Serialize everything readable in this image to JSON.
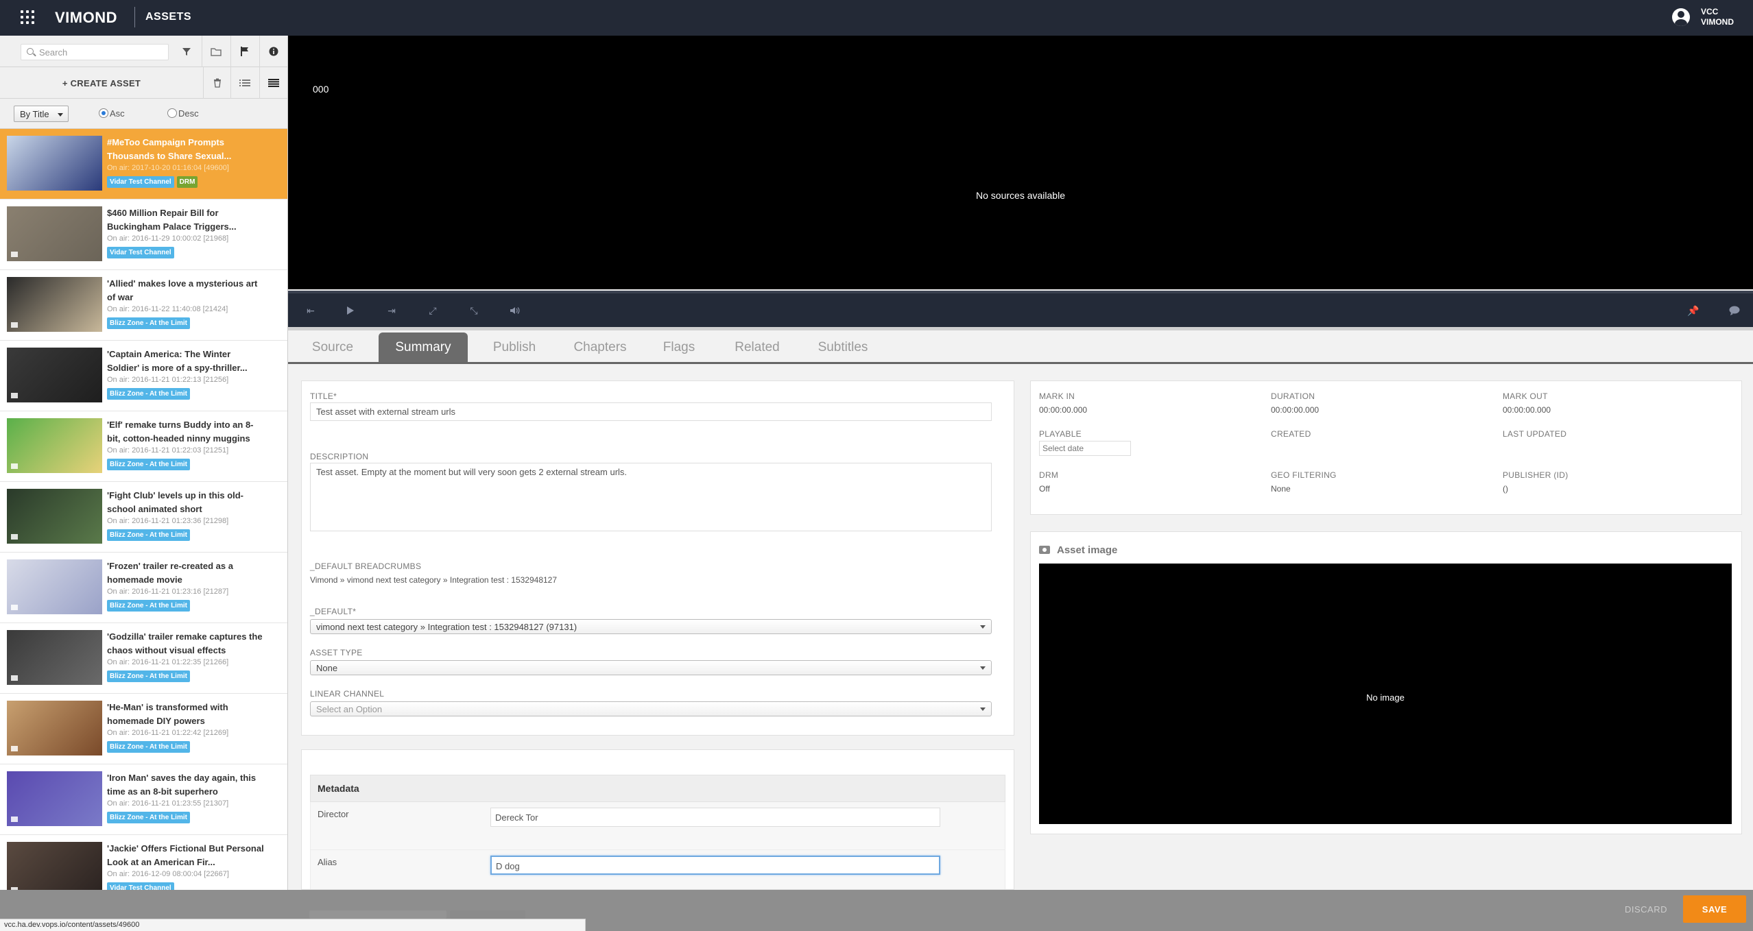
{
  "app": {
    "brand": "VIMOND",
    "section": "ASSETS",
    "user": [
      "VCC",
      "VIMOND"
    ]
  },
  "sidebar": {
    "search_placeholder": "Search",
    "create_label": "+ CREATE ASSET",
    "sort": {
      "by": "By Title",
      "asc": "Asc",
      "desc": "Desc",
      "selected": "Asc"
    },
    "assets": [
      {
        "title": "#MeToo Campaign Prompts Thousands to Share Sexual...",
        "meta": "On air: 2017-10-20 01:16:04 [49600]",
        "badges": [
          "Vidar Test Channel",
          "DRM"
        ],
        "selected": true
      },
      {
        "title": "$460 Million Repair Bill for Buckingham Palace Triggers...",
        "meta": "On air: 2016-11-29 10:00:02 [21968]",
        "badges": [
          "Vidar Test Channel"
        ]
      },
      {
        "title": "'Allied' makes love a mysterious art of war",
        "meta": "On air: 2016-11-22 11:40:08 [21424]",
        "badges": [
          "Blizz Zone - At the Limit"
        ]
      },
      {
        "title": "'Captain America: The Winter Soldier' is more of a spy-thriller...",
        "meta": "On air: 2016-11-21 01:22:13 [21256]",
        "badges": [
          "Blizz Zone - At the Limit"
        ]
      },
      {
        "title": "'Elf' remake turns Buddy into an 8-bit, cotton-headed ninny muggins",
        "meta": "On air: 2016-11-21 01:22:03 [21251]",
        "badges": [
          "Blizz Zone - At the Limit"
        ]
      },
      {
        "title": "'Fight Club' levels up in this old-school animated short",
        "meta": "On air: 2016-11-21 01:23:36 [21298]",
        "badges": [
          "Blizz Zone - At the Limit"
        ]
      },
      {
        "title": "'Frozen' trailer re-created as a homemade movie",
        "meta": "On air: 2016-11-21 01:23:16 [21287]",
        "badges": [
          "Blizz Zone - At the Limit"
        ]
      },
      {
        "title": "'Godzilla' trailer remake captures the chaos without visual effects",
        "meta": "On air: 2016-11-21 01:22:35 [21266]",
        "badges": [
          "Blizz Zone - At the Limit"
        ]
      },
      {
        "title": "'He-Man' is transformed with homemade DIY powers",
        "meta": "On air: 2016-11-21 01:22:42 [21269]",
        "badges": [
          "Blizz Zone - At the Limit"
        ]
      },
      {
        "title": "'Iron Man' saves the day again, this time as an 8-bit superhero",
        "meta": "On air: 2016-11-21 01:23:55 [21307]",
        "badges": [
          "Blizz Zone - At the Limit"
        ]
      },
      {
        "title": "'Jackie' Offers Fictional But Personal Look at an American Fir...",
        "meta": "On air: 2016-12-09 08:00:04 [22667]",
        "badges": [
          "Vidar Test Channel"
        ]
      }
    ]
  },
  "player": {
    "time": "000",
    "message": "No sources available"
  },
  "tabs": [
    "Source",
    "Summary",
    "Publish",
    "Chapters",
    "Flags",
    "Related",
    "Subtitles"
  ],
  "active_tab": "Summary",
  "summary": {
    "title_label": "TITLE*",
    "title_value": "Test asset with external stream urls",
    "description_label": "DESCRIPTION",
    "description_value": "Test asset. Empty at the moment but will very soon gets 2 external stream urls.",
    "breadcrumbs_label": "_DEFAULT BREADCRUMBS",
    "breadcrumbs_value": "Vimond » vimond next test category » Integration test : 1532948127",
    "default_label": "_DEFAULT*",
    "default_value": "vimond next test category » Integration test : 1532948127 (97131)",
    "asset_type_label": "ASSET TYPE",
    "asset_type_value": "None",
    "linear_channel_label": "LINEAR CHANNEL",
    "linear_channel_placeholder": "Select an Option"
  },
  "metadata": {
    "heading": "Metadata",
    "fields": [
      {
        "label": "Director",
        "value": "Dereck Tor"
      },
      {
        "label": "Alias",
        "value": "D dog"
      }
    ]
  },
  "info": {
    "mark_in_label": "MARK IN",
    "mark_in": "00:00:00.000",
    "duration_label": "DURATION",
    "duration": "00:00:00.000",
    "mark_out_label": "MARK OUT",
    "mark_out": "00:00:00.000",
    "playable_label": "PLAYABLE",
    "playable_placeholder": "Select date",
    "created_label": "CREATED",
    "last_updated_label": "LAST UPDATED",
    "drm_label": "DRM",
    "drm": "Off",
    "geo_label": "GEO FILTERING",
    "geo": "None",
    "publisher_label": "PUBLISHER (ID)",
    "publisher": "()"
  },
  "asset_image": {
    "heading": "Asset image",
    "message": "No image"
  },
  "actions": {
    "discard": "DISCARD",
    "save": "SAVE"
  },
  "status_url": "vcc.ha.dev.vops.io/content/assets/49600",
  "colors": {
    "topbar": "#232936",
    "selected": "#f4a73a",
    "channel_badge": "#52b5e8",
    "drm_badge": "#77a431",
    "save": "#f28a17"
  }
}
